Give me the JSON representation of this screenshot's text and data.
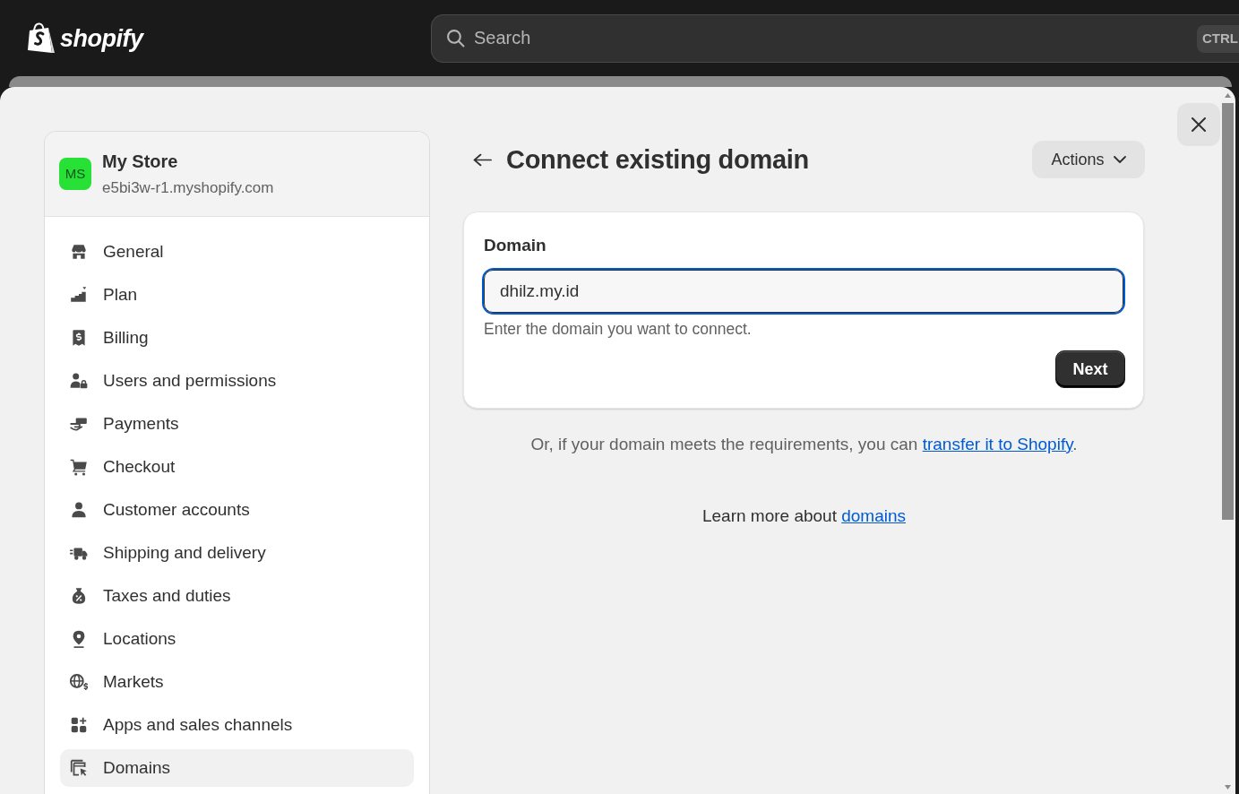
{
  "top_bar": {
    "logo": "shopify",
    "search": {
      "placeholder": "Search",
      "shortcut": "CTRL"
    }
  },
  "store": {
    "initials": "MS",
    "name": "My Store",
    "domain": "e5bi3w-r1.myshopify.com"
  },
  "nav": [
    {
      "label": "General",
      "selected": false
    },
    {
      "label": "Plan",
      "selected": false
    },
    {
      "label": "Billing",
      "selected": false
    },
    {
      "label": "Users and permissions",
      "selected": false
    },
    {
      "label": "Payments",
      "selected": false
    },
    {
      "label": "Checkout",
      "selected": false
    },
    {
      "label": "Customer accounts",
      "selected": false
    },
    {
      "label": "Shipping and delivery",
      "selected": false
    },
    {
      "label": "Taxes and duties",
      "selected": false
    },
    {
      "label": "Locations",
      "selected": false
    },
    {
      "label": "Markets",
      "selected": false
    },
    {
      "label": "Apps and sales channels",
      "selected": false
    },
    {
      "label": "Domains",
      "selected": true
    }
  ],
  "page": {
    "title": "Connect existing domain",
    "actions": "Actions"
  },
  "domain_card": {
    "label": "Domain",
    "input": {
      "value": "dhilz.my.id",
      "focused": true
    },
    "help": "Enter the domain you want to connect.",
    "button": "Next"
  },
  "transfer_note": {
    "text": "Or, if your domain meets the requirements, you can",
    "link": "transfer it to Shopify",
    "end": "."
  },
  "learn_more": {
    "text": "Learn more about",
    "link": "domains"
  }
}
